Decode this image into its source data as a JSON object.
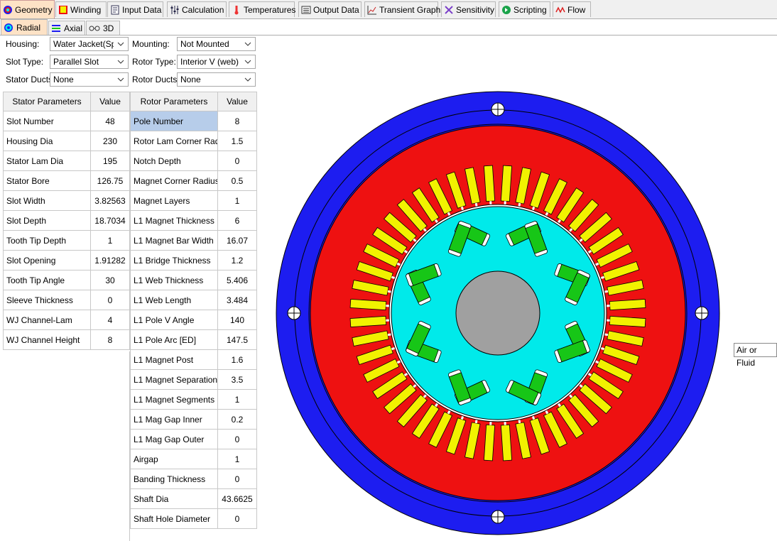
{
  "main_tabs": [
    {
      "label": "Geometry",
      "icon": "geometry-icon",
      "active": true
    },
    {
      "label": "Winding",
      "icon": "winding-icon"
    },
    {
      "label": "Input Data",
      "icon": "input-data-icon"
    },
    {
      "label": "Calculation",
      "icon": "calculation-icon"
    },
    {
      "label": "Temperatures",
      "icon": "thermometer-icon"
    },
    {
      "label": "Output Data",
      "icon": "output-data-icon"
    },
    {
      "label": "Transient Graph",
      "icon": "graph-icon"
    },
    {
      "label": "Sensitivity",
      "icon": "sensitivity-icon"
    },
    {
      "label": "Scripting",
      "icon": "scripting-icon"
    },
    {
      "label": "Flow",
      "icon": "flow-icon"
    }
  ],
  "sub_tabs": [
    {
      "label": "Radial",
      "icon": "radial-icon",
      "active": true
    },
    {
      "label": "Axial",
      "icon": "axial-icon"
    },
    {
      "label": "3D",
      "icon": "3d-glasses-icon"
    }
  ],
  "form": {
    "housing_label": "Housing:",
    "housing_value": "Water Jacket(Spira",
    "mounting_label": "Mounting:",
    "mounting_value": "Not Mounted",
    "slot_type_label": "Slot Type:",
    "slot_type_value": "Parallel Slot",
    "rotor_type_label": "Rotor Type:",
    "rotor_type_value": "Interior V (web)",
    "stator_ducts_label": "Stator Ducts:",
    "stator_ducts_value": "None",
    "rotor_ducts_label": "Rotor Ducts:",
    "rotor_ducts_value": "None"
  },
  "stator_table": {
    "headers": [
      "Stator Parameters",
      "Value"
    ],
    "rows": [
      [
        "Slot Number",
        "48"
      ],
      [
        "Housing Dia",
        "230"
      ],
      [
        "Stator Lam Dia",
        "195"
      ],
      [
        "Stator Bore",
        "126.75"
      ],
      [
        "Slot Width",
        "3.82563"
      ],
      [
        "Slot Depth",
        "18.7034"
      ],
      [
        "Tooth Tip Depth",
        "1"
      ],
      [
        "Slot Opening",
        "1.91282"
      ],
      [
        "Tooth Tip Angle",
        "30"
      ],
      [
        "Sleeve Thickness",
        "0"
      ],
      [
        "WJ Channel-Lam",
        "4"
      ],
      [
        "WJ Channel Height",
        "8"
      ]
    ]
  },
  "rotor_table": {
    "headers": [
      "Rotor Parameters",
      "Value"
    ],
    "rows": [
      [
        "Pole Number",
        "8"
      ],
      [
        "Rotor Lam Corner Radius",
        "1.5"
      ],
      [
        "Notch Depth",
        "0"
      ],
      [
        "Magnet Corner Radius",
        "0.5"
      ],
      [
        "Magnet Layers",
        "1"
      ],
      [
        "L1 Magnet Thickness",
        "6"
      ],
      [
        "L1 Magnet Bar Width",
        "16.07"
      ],
      [
        "L1 Bridge Thickness",
        "1.2"
      ],
      [
        "L1 Web Thickness",
        "5.406"
      ],
      [
        "L1 Web Length",
        "3.484"
      ],
      [
        "L1 Pole V Angle",
        "140"
      ],
      [
        "L1 Pole Arc [ED]",
        "147.5"
      ],
      [
        "L1 Magnet Post",
        "1.6"
      ],
      [
        "L1 Magnet Separation",
        "3.5"
      ],
      [
        "L1 Magnet Segments",
        "1"
      ],
      [
        "L1 Mag Gap Inner",
        "0.2"
      ],
      [
        "L1 Mag Gap Outer",
        "0"
      ],
      [
        "Airgap",
        "1"
      ],
      [
        "Banding Thickness",
        "0"
      ],
      [
        "Shaft Dia",
        "43.6625"
      ],
      [
        "Shaft Hole Diameter",
        "0"
      ]
    ]
  },
  "tooltip": "Air or Fluid",
  "colors": {
    "housing": "#1d1df0",
    "stator_lam": "#ee1111",
    "winding": "#f2f200",
    "rotor": "#00eaea",
    "magnet": "#17c617",
    "shaft": "#a0a0a0",
    "tab_active": "#fde2c6",
    "selected_cell": "#b7cdea"
  }
}
